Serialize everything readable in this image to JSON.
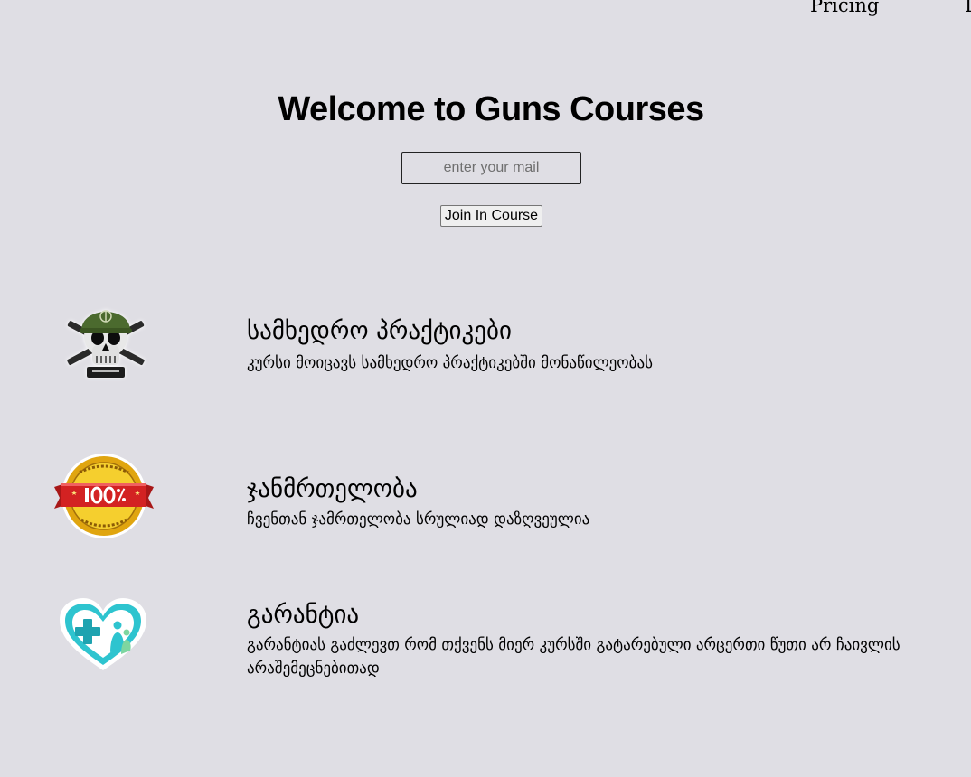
{
  "nav": {
    "pricing_label": "Pricing",
    "clipped_label": "L"
  },
  "hero": {
    "title": "Welcome to Guns Courses",
    "email_placeholder": "enter your mail",
    "join_label": "Join In Course"
  },
  "features": [
    {
      "icon": "skull-helmet-icon",
      "title": "სამხედრო პრაქტიკები",
      "description": "კურსი მოიცავს სამხედრო პრაქტიკებში მონაწილეობას"
    },
    {
      "icon": "satisfaction-guarantee-badge-icon",
      "title": "ჯანმრთელობა",
      "description": "ჩვენთან ჯამრთელობა სრულიად დაზღვეულია"
    },
    {
      "icon": "health-heart-icon",
      "title": "გარანტია",
      "description": "გარანტიას გაძლევთ რომ თქვენს მიერ კურსში გატარებული არცერთი წუთი არ ჩაივლის არაშემეცნებითად"
    }
  ],
  "colors": {
    "background": "#dfdee4",
    "helmet_green": "#4c6b2e",
    "badge_red": "#d32222",
    "badge_gold": "#f2c21b",
    "health_teal": "#2ec4cf"
  }
}
